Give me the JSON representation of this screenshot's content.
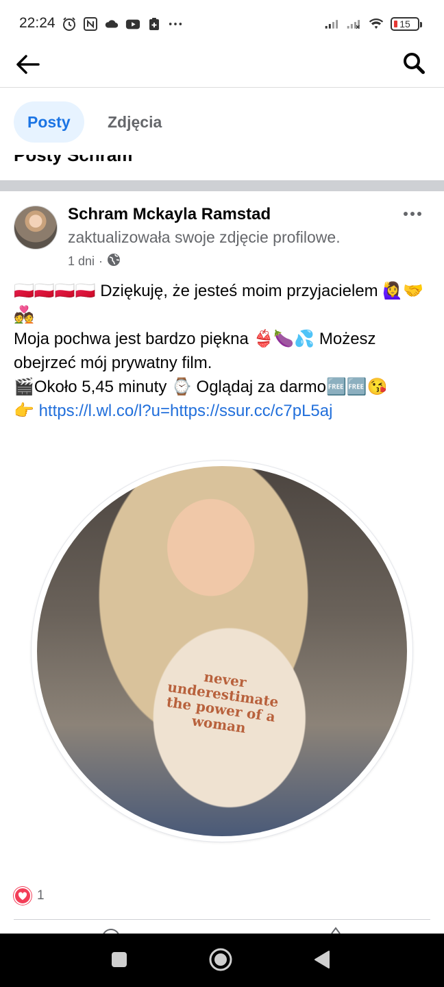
{
  "status_bar": {
    "time": "22:24",
    "battery": "15",
    "icons_left": [
      "alarm-icon",
      "nfc-icon",
      "cloud-icon",
      "youtube-icon",
      "clipboard-icon",
      "more-dots"
    ],
    "icons_right": [
      "signal-icon",
      "signal-no-service-icon",
      "wifi-icon",
      "battery-icon"
    ]
  },
  "topbar": {
    "back_icon": "arrow-left-icon",
    "search_icon": "search-icon"
  },
  "tabs": [
    {
      "label": "Posty",
      "active": true
    },
    {
      "label": "Zdjęcia",
      "active": false
    }
  ],
  "section_title": "Posty Schram",
  "post": {
    "author": "Schram Mckayla Ramstad",
    "action": "zaktualizowała swoje zdjęcie profilowe.",
    "time": "1 dni",
    "separator": "·",
    "privacy_icon": "globe-icon",
    "body_line1": "🇵🇱🇵🇱🇵🇱🇵🇱 Dziękuję, że jesteś moim przyjacielem 🙋‍♀️🤝💑",
    "body_line2": "Moja pochwa jest bardzo piękna 👙🍆💦 Możesz obejrzeć mój prywatny film.",
    "body_line3": "🎬Około 5,45 minuty ⌚ Oglądaj za darmo🆓🆓😘",
    "link_prefix": "👉 ",
    "link": "https://l.wl.co/l?u=https://ssur.cc/c7pL5aj",
    "shirt_text": "never underestimate the power of a woman",
    "reaction_count": "1",
    "reaction_type": "heart-icon"
  },
  "nav": {
    "recents": "square-icon",
    "home": "circle-icon",
    "back": "triangle-back-icon"
  },
  "colors": {
    "accent": "#1b74e4",
    "link": "#216fdb",
    "tab_active_bg": "#e7f3ff",
    "reaction": "#f33e58",
    "secondary_text": "#65676b"
  }
}
